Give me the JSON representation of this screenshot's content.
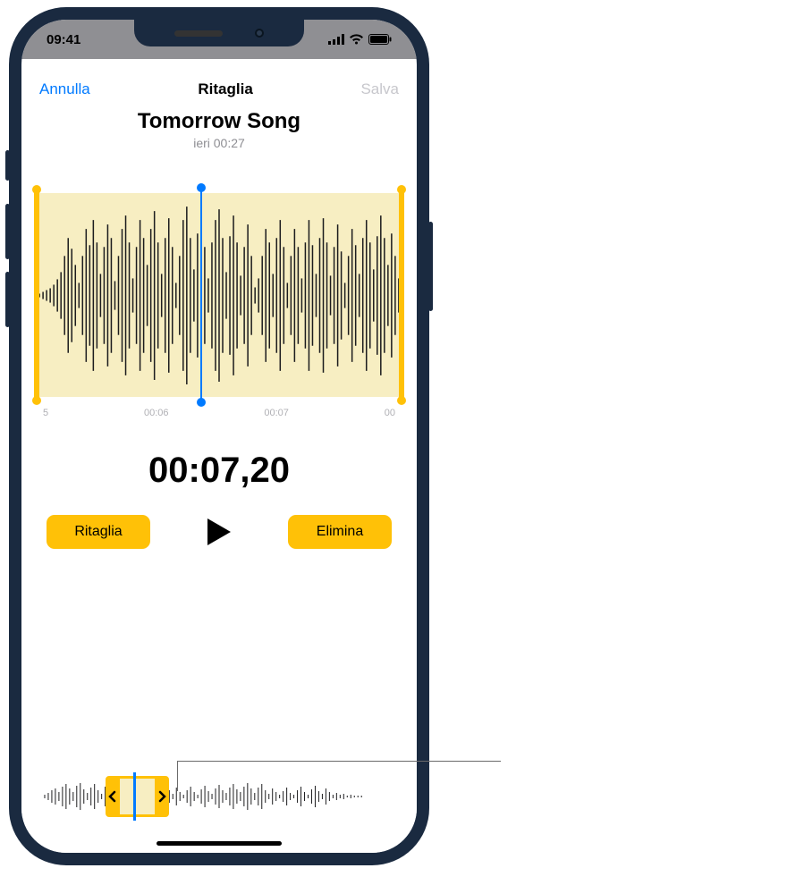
{
  "status": {
    "time": "09:41"
  },
  "nav": {
    "cancel": "Annulla",
    "title": "Ritaglia",
    "save": "Salva"
  },
  "recording": {
    "title": "Tomorrow Song",
    "subtitle": "ieri  00:27"
  },
  "ticks": {
    "t1": "5",
    "t2": "00:06",
    "t3": "00:07",
    "t4": "00"
  },
  "timer": "00:07,20",
  "buttons": {
    "trim": "Ritaglia",
    "delete": "Elimina"
  },
  "overview": {
    "selection_left_pct": 18,
    "selection_width_pct": 18,
    "playhead_pct": 26
  }
}
